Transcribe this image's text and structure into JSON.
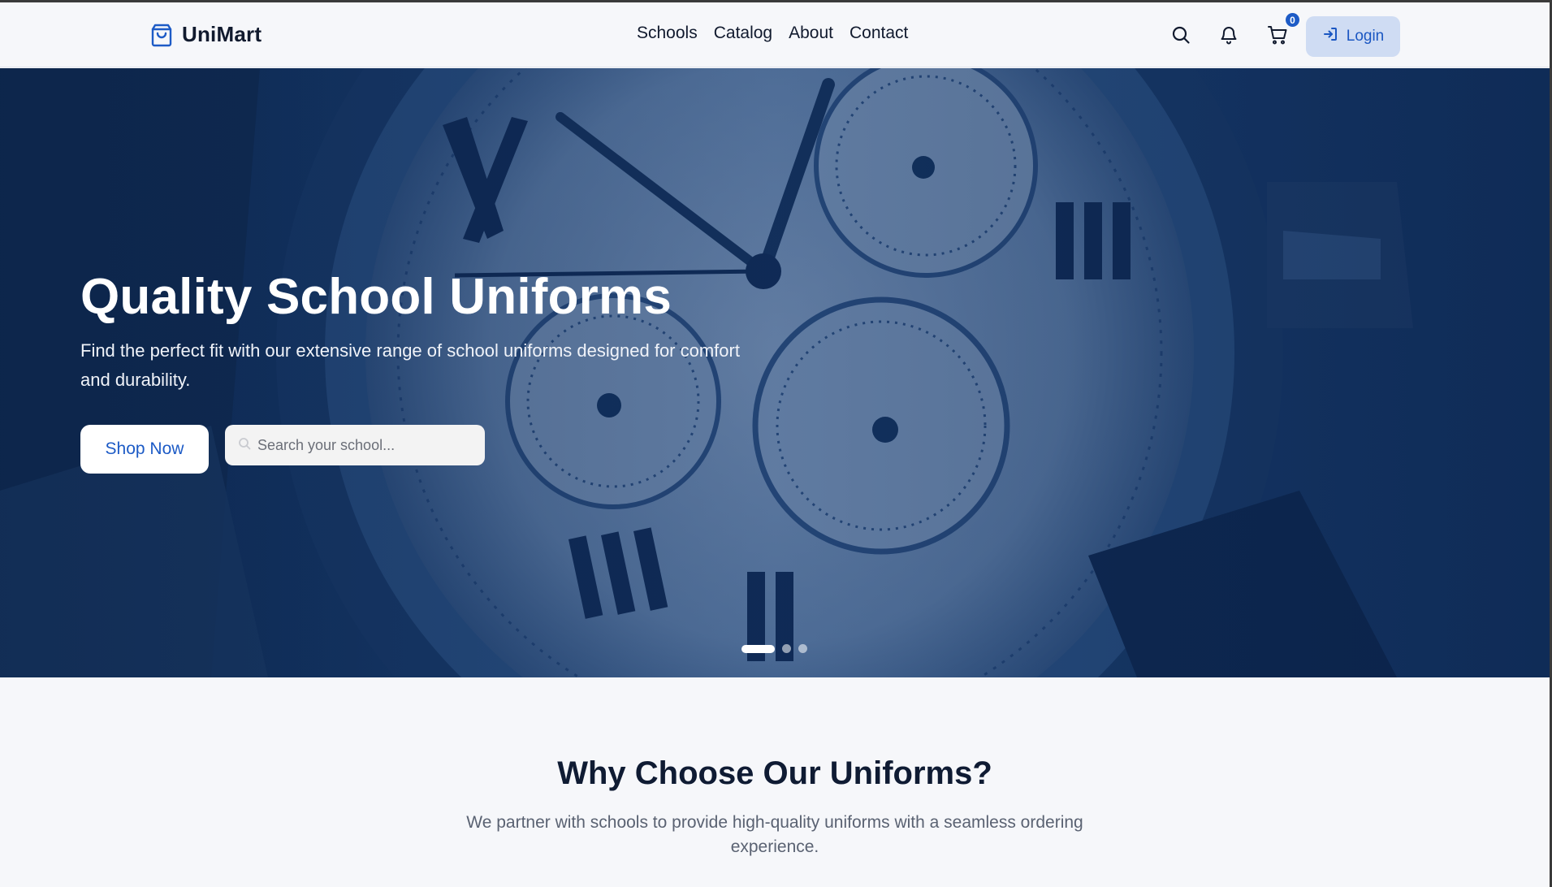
{
  "brand": {
    "name": "UniMart",
    "icon": "shopping-bag-icon",
    "accent": "#1d5bc6"
  },
  "nav": {
    "items": [
      {
        "label": "Schools"
      },
      {
        "label": "Catalog"
      },
      {
        "label": "About"
      },
      {
        "label": "Contact"
      }
    ]
  },
  "header_actions": {
    "search_icon": "search-icon",
    "bell_icon": "bell-icon",
    "cart_icon": "cart-icon",
    "cart_count": "0",
    "login_label": "Login",
    "login_icon": "login-icon"
  },
  "hero": {
    "title": "Quality School Uniforms",
    "subtitle": "Find the perfect fit with our extensive range of school uniforms designed for comfort and durability.",
    "cta_label": "Shop Now",
    "search_placeholder": "Search your school...",
    "search_value": "",
    "carousel": {
      "slide_count": 3,
      "active_slide": 1
    }
  },
  "why": {
    "title": "Why Choose Our Uniforms?",
    "subtitle": "We partner with schools to provide high-quality uniforms with a seamless ordering experience."
  }
}
